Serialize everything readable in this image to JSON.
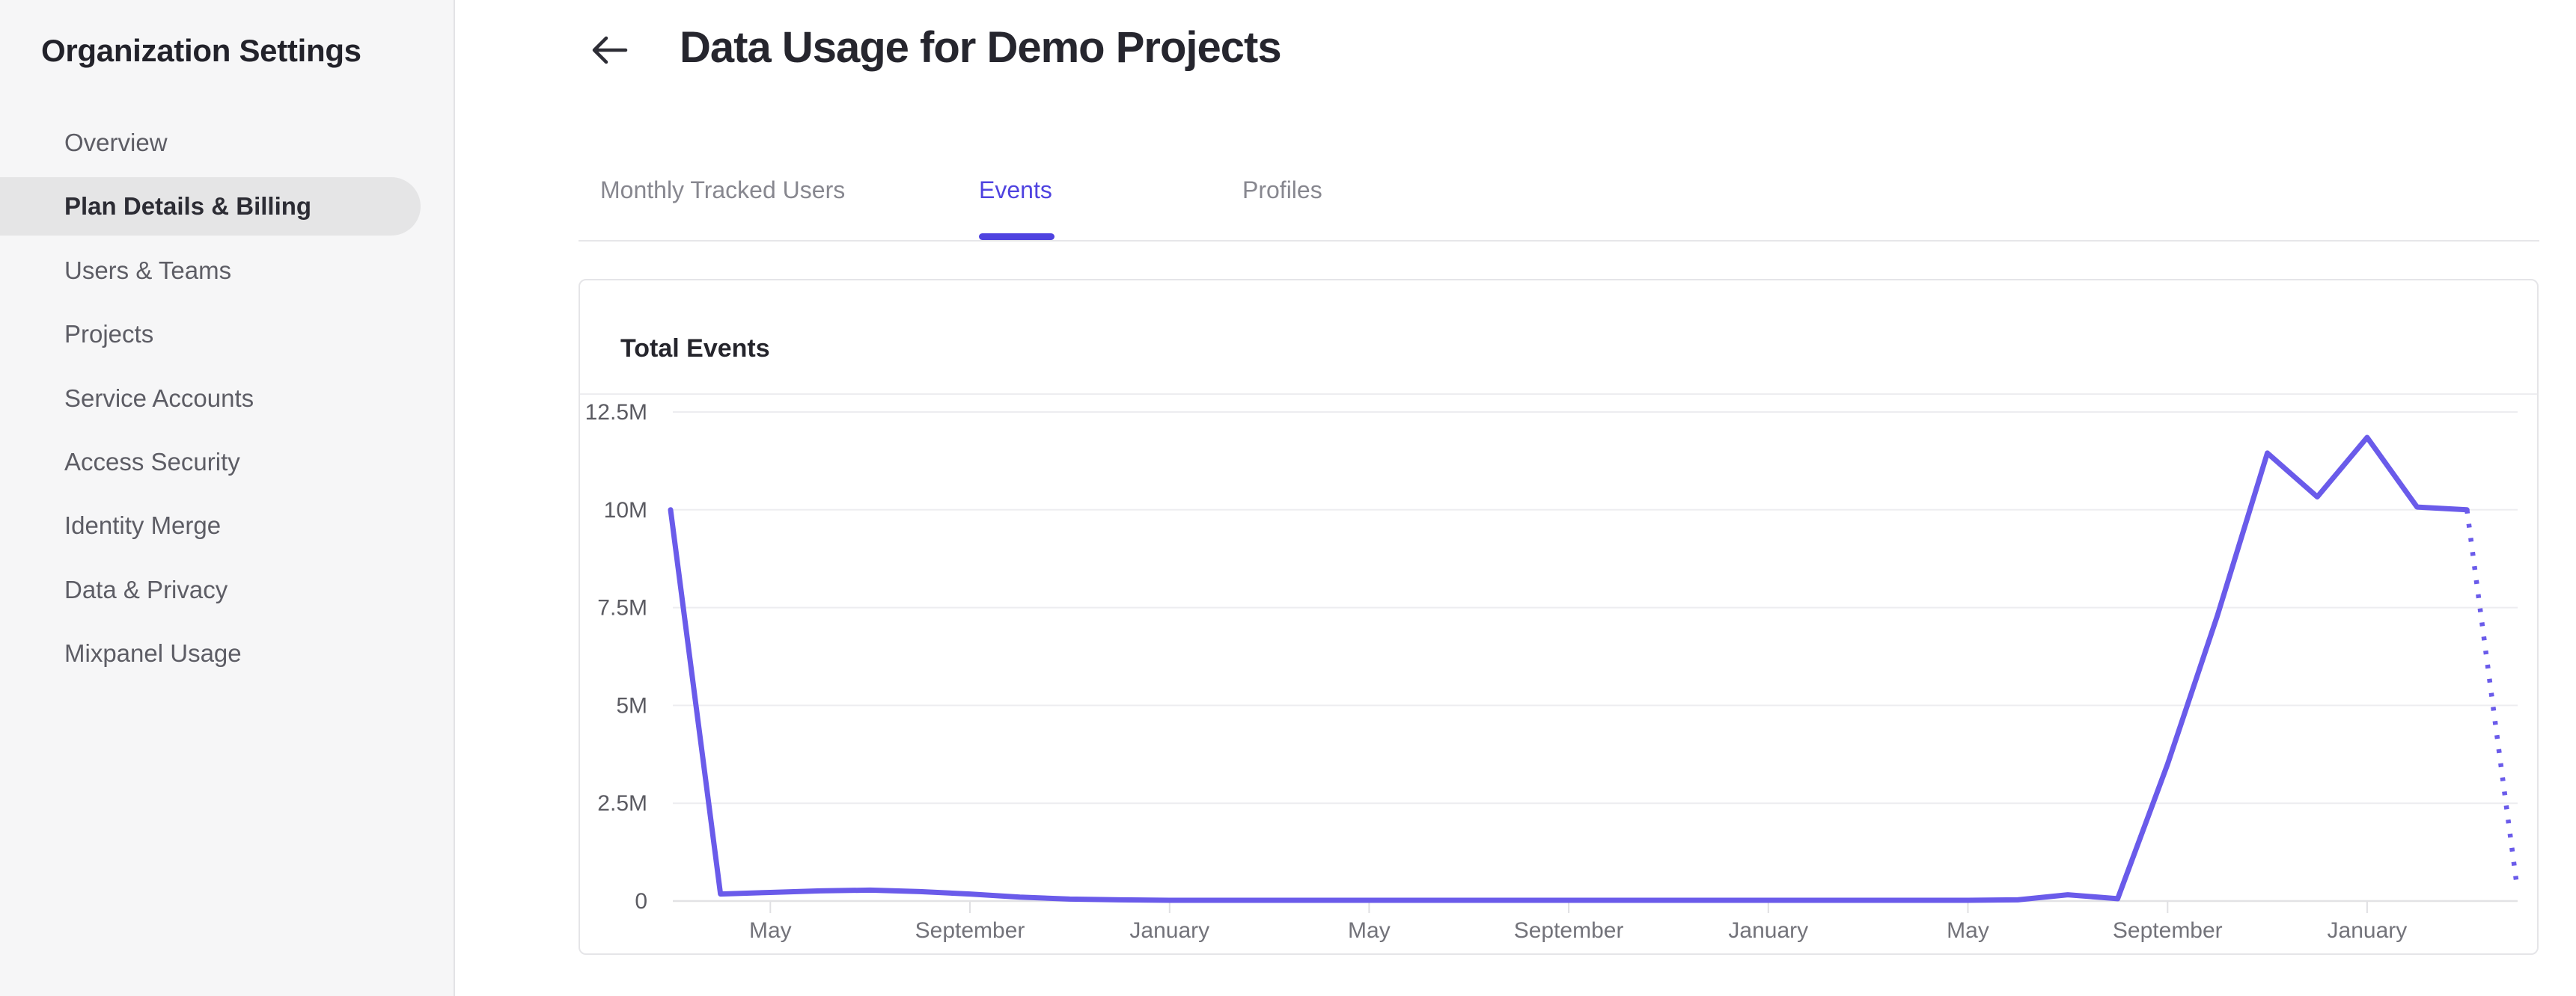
{
  "sidebar": {
    "title": "Organization Settings",
    "items": [
      {
        "label": "Overview",
        "active": false
      },
      {
        "label": "Plan Details & Billing",
        "active": true
      },
      {
        "label": "Users & Teams",
        "active": false
      },
      {
        "label": "Projects",
        "active": false
      },
      {
        "label": "Service Accounts",
        "active": false
      },
      {
        "label": "Access Security",
        "active": false
      },
      {
        "label": "Identity Merge",
        "active": false
      },
      {
        "label": "Data & Privacy",
        "active": false
      },
      {
        "label": "Mixpanel Usage",
        "active": false
      }
    ]
  },
  "header": {
    "title": "Data Usage for Demo Projects",
    "back_icon": "arrow-left"
  },
  "tabs": [
    {
      "label": "Monthly Tracked Users",
      "active": false
    },
    {
      "label": "Events",
      "active": true
    },
    {
      "label": "Profiles",
      "active": false
    }
  ],
  "card": {
    "title": "Total Events"
  },
  "colors": {
    "accent": "#4F43E0",
    "line": "#6A5BEA",
    "active_item_bg": "#E5E5E6",
    "grid": "#EDEDF0",
    "axis_label": "#5B5B62",
    "month_label": "#73737A"
  },
  "chart_data": {
    "type": "line",
    "title": "Total Events",
    "unit": "events",
    "x": [
      "Mar",
      "Apr",
      "May",
      "Jun",
      "Jul",
      "Aug",
      "Sep",
      "Oct",
      "Nov",
      "Dec",
      "Jan",
      "Feb",
      "Mar",
      "Apr",
      "May",
      "Jun",
      "Jul",
      "Aug",
      "Sep",
      "Oct",
      "Nov",
      "Dec",
      "Jan",
      "Feb",
      "Mar",
      "Apr",
      "May",
      "Jun",
      "Jul",
      "Aug",
      "Sep",
      "Oct",
      "Nov",
      "Dec",
      "Jan",
      "Feb",
      "Mar",
      "Apr"
    ],
    "values": [
      10000000,
      180000,
      220000,
      260000,
      280000,
      240000,
      180000,
      100000,
      50000,
      30000,
      20000,
      20000,
      20000,
      20000,
      20000,
      20000,
      20000,
      20000,
      20000,
      20000,
      20000,
      20000,
      20000,
      20000,
      20000,
      20000,
      20000,
      30000,
      160000,
      60000,
      3500000,
      7300000,
      11450000,
      10330000,
      11850000,
      10070000,
      10000000,
      400000
    ],
    "projected_point_index": 37,
    "last_segment_dotted": true,
    "x_tick_indices": [
      2,
      6,
      10,
      14,
      18,
      22,
      26,
      30,
      34
    ],
    "x_tick_labels": [
      "May",
      "September",
      "January",
      "May",
      "September",
      "January",
      "May",
      "September",
      "January"
    ],
    "y_ticks": [
      {
        "value": 0,
        "label": "0"
      },
      {
        "value": 2500000,
        "label": "2.5M"
      },
      {
        "value": 5000000,
        "label": "5M"
      },
      {
        "value": 7500000,
        "label": "7.5M"
      },
      {
        "value": 10000000,
        "label": "10M"
      },
      {
        "value": 12500000,
        "label": "12.5M"
      }
    ],
    "ylim": [
      0,
      12500000
    ],
    "grid": true,
    "legend": false,
    "line_color": "#6A5BEA"
  }
}
